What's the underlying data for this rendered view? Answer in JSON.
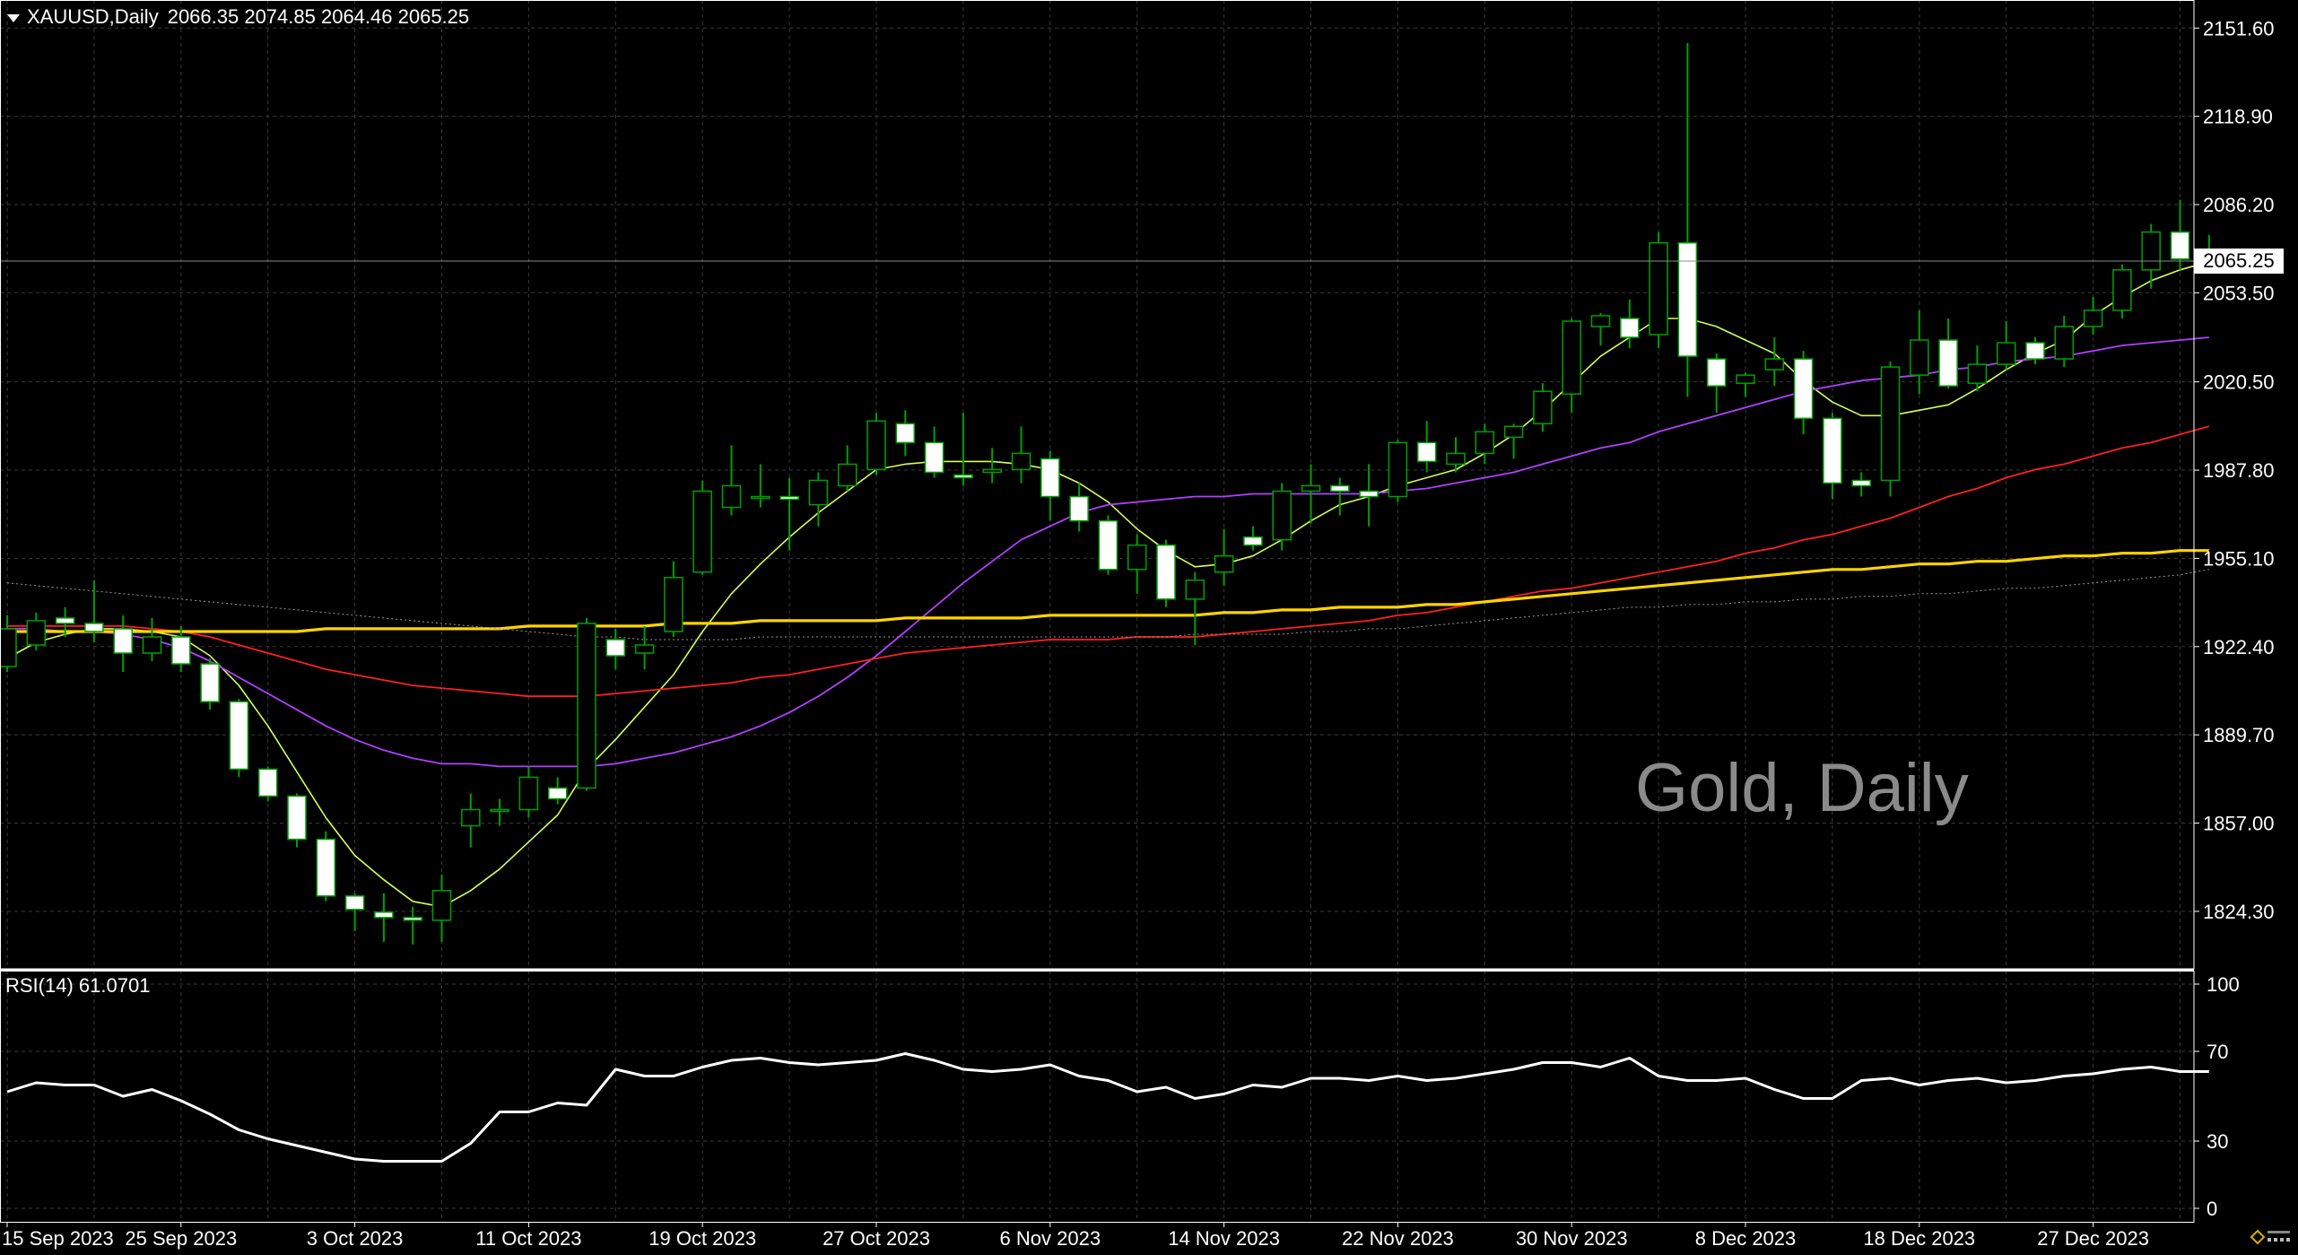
{
  "symbol_header": {
    "symbol": "XAUUSD,Daily",
    "ohlc": "2066.35 2074.85 2064.46 2065.25"
  },
  "watermark": "Gold, Daily",
  "rsi_header": "RSI(14) 61.0701",
  "current_price_label": "2065.25",
  "colors": {
    "background": "#000000",
    "grid": "#3a3a3a",
    "bull_candle": "#00a000",
    "bear_candle_fill": "#ffffff",
    "ma_fast": "#d4ff5c",
    "ma_mid": "#b040ff",
    "ma_slow": "#ff2020",
    "ma_long": "#ffd400",
    "ma_longest": "#9a9a9a",
    "rsi": "#ffffff"
  },
  "chart_data": {
    "type": "candlestick",
    "price_axis": {
      "ticks": [
        2151.6,
        2118.9,
        2086.2,
        2053.5,
        2020.5,
        1987.8,
        1955.1,
        1922.4,
        1889.7,
        1857.0,
        1824.3
      ],
      "labels": [
        "2151.60",
        "2118.90",
        "2086.20",
        "2053.50",
        "2020.50",
        "1987.80",
        "1955.10",
        "1922.40",
        "1889.70",
        "1857.00",
        "1824.30"
      ],
      "range": [
        1803,
        2162
      ],
      "current": 2065.25
    },
    "x_axis": {
      "labels": [
        "15 Sep 2023",
        "25 Sep 2023",
        "3 Oct 2023",
        "11 Oct 2023",
        "19 Oct 2023",
        "27 Oct 2023",
        "6 Nov 2023",
        "14 Nov 2023",
        "22 Nov 2023",
        "30 Nov 2023",
        "8 Dec 2023",
        "18 Dec 2023",
        "27 Dec 2023"
      ],
      "label_bar_index": [
        0,
        6,
        12,
        18,
        24,
        30,
        36,
        42,
        48,
        54,
        60,
        66,
        72
      ]
    },
    "candles": [
      {
        "o": 1915,
        "h": 1934,
        "l": 1913,
        "c": 1929
      },
      {
        "o": 1923,
        "h": 1935,
        "l": 1921,
        "c": 1932
      },
      {
        "o": 1933,
        "h": 1937,
        "l": 1926,
        "c": 1931
      },
      {
        "o": 1931,
        "h": 1947,
        "l": 1924,
        "c": 1928
      },
      {
        "o": 1929,
        "h": 1934,
        "l": 1913,
        "c": 1920
      },
      {
        "o": 1920,
        "h": 1933,
        "l": 1917,
        "c": 1926
      },
      {
        "o": 1926,
        "h": 1930,
        "l": 1913,
        "c": 1916
      },
      {
        "o": 1916,
        "h": 1918,
        "l": 1899,
        "c": 1902
      },
      {
        "o": 1902,
        "h": 1903,
        "l": 1874,
        "c": 1877
      },
      {
        "o": 1877,
        "h": 1878,
        "l": 1865,
        "c": 1867
      },
      {
        "o": 1867,
        "h": 1868,
        "l": 1848,
        "c": 1851
      },
      {
        "o": 1851,
        "h": 1854,
        "l": 1828,
        "c": 1830
      },
      {
        "o": 1830,
        "h": 1831,
        "l": 1817,
        "c": 1825
      },
      {
        "o": 1824,
        "h": 1831,
        "l": 1813,
        "c": 1822
      },
      {
        "o": 1822,
        "h": 1826,
        "l": 1812,
        "c": 1821
      },
      {
        "o": 1821,
        "h": 1838,
        "l": 1813,
        "c": 1832
      },
      {
        "o": 1856,
        "h": 1868,
        "l": 1848,
        "c": 1862
      },
      {
        "o": 1862,
        "h": 1866,
        "l": 1856,
        "c": 1862
      },
      {
        "o": 1862,
        "h": 1878,
        "l": 1859,
        "c": 1874
      },
      {
        "o": 1870,
        "h": 1874,
        "l": 1864,
        "c": 1866
      },
      {
        "o": 1870,
        "h": 1933,
        "l": 1869,
        "c": 1931
      },
      {
        "o": 1925,
        "h": 1929,
        "l": 1914,
        "c": 1919
      },
      {
        "o": 1920,
        "h": 1930,
        "l": 1914,
        "c": 1923
      },
      {
        "o": 1928,
        "h": 1954,
        "l": 1926,
        "c": 1948
      },
      {
        "o": 1950,
        "h": 1984,
        "l": 1949,
        "c": 1980
      },
      {
        "o": 1974,
        "h": 1997,
        "l": 1971,
        "c": 1982
      },
      {
        "o": 1978,
        "h": 1990,
        "l": 1974,
        "c": 1978
      },
      {
        "o": 1978,
        "h": 1985,
        "l": 1958,
        "c": 1977
      },
      {
        "o": 1975,
        "h": 1987,
        "l": 1967,
        "c": 1984
      },
      {
        "o": 1982,
        "h": 1997,
        "l": 1980,
        "c": 1990
      },
      {
        "o": 1988,
        "h": 2009,
        "l": 1986,
        "c": 2006
      },
      {
        "o": 2005,
        "h": 2010,
        "l": 1993,
        "c": 1998
      },
      {
        "o": 1998,
        "h": 2004,
        "l": 1985,
        "c": 1987
      },
      {
        "o": 1986,
        "h": 2009,
        "l": 1982,
        "c": 1985
      },
      {
        "o": 1987,
        "h": 1996,
        "l": 1983,
        "c": 1988
      },
      {
        "o": 1988,
        "h": 2004,
        "l": 1983,
        "c": 1994
      },
      {
        "o": 1992,
        "h": 1995,
        "l": 1969,
        "c": 1978
      },
      {
        "o": 1978,
        "h": 1983,
        "l": 1965,
        "c": 1969
      },
      {
        "o": 1969,
        "h": 1971,
        "l": 1949,
        "c": 1951
      },
      {
        "o": 1951,
        "h": 1964,
        "l": 1942,
        "c": 1960
      },
      {
        "o": 1960,
        "h": 1962,
        "l": 1937,
        "c": 1940
      },
      {
        "o": 1940,
        "h": 1950,
        "l": 1923,
        "c": 1947
      },
      {
        "o": 1950,
        "h": 1966,
        "l": 1945,
        "c": 1956
      },
      {
        "o": 1963,
        "h": 1967,
        "l": 1958,
        "c": 1960
      },
      {
        "o": 1962,
        "h": 1983,
        "l": 1958,
        "c": 1980
      },
      {
        "o": 1980,
        "h": 1990,
        "l": 1968,
        "c": 1982
      },
      {
        "o": 1982,
        "h": 1985,
        "l": 1971,
        "c": 1980
      },
      {
        "o": 1980,
        "h": 1990,
        "l": 1967,
        "c": 1978
      },
      {
        "o": 1978,
        "h": 1999,
        "l": 1976,
        "c": 1998
      },
      {
        "o": 1998,
        "h": 2006,
        "l": 1987,
        "c": 1991
      },
      {
        "o": 1990,
        "h": 2000,
        "l": 1987,
        "c": 1994
      },
      {
        "o": 1994,
        "h": 2005,
        "l": 1990,
        "c": 2002
      },
      {
        "o": 2000,
        "h": 2005,
        "l": 1992,
        "c": 2004
      },
      {
        "o": 2005,
        "h": 2020,
        "l": 2002,
        "c": 2017
      },
      {
        "o": 2016,
        "h": 2044,
        "l": 2009,
        "c": 2043
      },
      {
        "o": 2041,
        "h": 2046,
        "l": 2034,
        "c": 2045
      },
      {
        "o": 2044,
        "h": 2051,
        "l": 2033,
        "c": 2037
      },
      {
        "o": 2038,
        "h": 2076,
        "l": 2033,
        "c": 2072
      },
      {
        "o": 2072,
        "h": 2146,
        "l": 2015,
        "c": 2030
      },
      {
        "o": 2029,
        "h": 2031,
        "l": 2009,
        "c": 2019
      },
      {
        "o": 2020,
        "h": 2024,
        "l": 2015,
        "c": 2023
      },
      {
        "o": 2025,
        "h": 2037,
        "l": 2019,
        "c": 2029
      },
      {
        "o": 2029,
        "h": 2032,
        "l": 2001,
        "c": 2007
      },
      {
        "o": 2007,
        "h": 2009,
        "l": 1977,
        "c": 1983
      },
      {
        "o": 1984,
        "h": 1987,
        "l": 1978,
        "c": 1982
      },
      {
        "o": 1984,
        "h": 2028,
        "l": 1978,
        "c": 2026
      },
      {
        "o": 2023,
        "h": 2047,
        "l": 2016,
        "c": 2036
      },
      {
        "o": 2036,
        "h": 2044,
        "l": 2018,
        "c": 2019
      },
      {
        "o": 2020,
        "h": 2034,
        "l": 2017,
        "c": 2027
      },
      {
        "o": 2027,
        "h": 2043,
        "l": 2025,
        "c": 2035
      },
      {
        "o": 2035,
        "h": 2037,
        "l": 2027,
        "c": 2029
      },
      {
        "o": 2029,
        "h": 2045,
        "l": 2026,
        "c": 2041
      },
      {
        "o": 2041,
        "h": 2052,
        "l": 2038,
        "c": 2047
      },
      {
        "o": 2047,
        "h": 2064,
        "l": 2044,
        "c": 2062
      },
      {
        "o": 2062,
        "h": 2079,
        "l": 2055,
        "c": 2076
      },
      {
        "o": 2076,
        "h": 2088,
        "l": 2062,
        "c": 2066
      },
      {
        "o": 2066,
        "h": 2075,
        "l": 2064,
        "c": 2065
      }
    ],
    "ma_series": [
      {
        "color_key": "ma_fast",
        "width": 1.6,
        "values": [
          1918,
          1924,
          1927,
          1929,
          1929,
          1928,
          1926,
          1919,
          1908,
          1893,
          1876,
          1859,
          1845,
          1836,
          1828,
          1826,
          1832,
          1840,
          1850,
          1860,
          1877,
          1888,
          1900,
          1912,
          1928,
          1942,
          1953,
          1963,
          1972,
          1980,
          1988,
          1990,
          1991,
          1991,
          1991,
          1990,
          1988,
          1983,
          1976,
          1966,
          1958,
          1952,
          1953,
          1956,
          1962,
          1969,
          1975,
          1978,
          1982,
          1985,
          1988,
          1994,
          2001,
          2010,
          2020,
          2030,
          2037,
          2044,
          2044,
          2041,
          2036,
          2031,
          2021,
          2013,
          2008,
          2008,
          2010,
          2012,
          2018,
          2025,
          2031,
          2036,
          2045,
          2052,
          2058,
          2062,
          2065
        ]
      },
      {
        "color_key": "ma_mid",
        "width": 1.8,
        "values": [
          1929,
          1929,
          1928,
          1928,
          1927,
          1925,
          1922,
          1917,
          1911,
          1905,
          1899,
          1893,
          1888,
          1884,
          1881,
          1879,
          1879,
          1878,
          1878,
          1878,
          1878,
          1879,
          1881,
          1883,
          1886,
          1889,
          1893,
          1898,
          1904,
          1911,
          1919,
          1928,
          1937,
          1946,
          1954,
          1962,
          1967,
          1972,
          1975,
          1976,
          1977,
          1978,
          1978,
          1979,
          1979,
          1979,
          1979,
          1979,
          1980,
          1981,
          1983,
          1985,
          1987,
          1990,
          1993,
          1996,
          1998,
          2002,
          2005,
          2008,
          2011,
          2014,
          2017,
          2019,
          2021,
          2022,
          2023,
          2025,
          2026,
          2028,
          2029,
          2030,
          2032,
          2034,
          2035,
          2036,
          2037
        ]
      },
      {
        "color_key": "ma_slow",
        "width": 1.8,
        "values": [
          1930,
          1930,
          1930,
          1930,
          1930,
          1929,
          1928,
          1926,
          1923,
          1920,
          1917,
          1914,
          1912,
          1910,
          1908,
          1907,
          1906,
          1905,
          1904,
          1904,
          1904,
          1905,
          1906,
          1907,
          1908,
          1909,
          1911,
          1912,
          1914,
          1916,
          1918,
          1920,
          1921,
          1922,
          1923,
          1924,
          1925,
          1925,
          1925,
          1926,
          1926,
          1926,
          1927,
          1928,
          1929,
          1930,
          1931,
          1932,
          1934,
          1935,
          1937,
          1939,
          1941,
          1943,
          1944,
          1946,
          1948,
          1950,
          1952,
          1954,
          1957,
          1959,
          1962,
          1964,
          1967,
          1970,
          1974,
          1978,
          1981,
          1985,
          1988,
          1990,
          1993,
          1996,
          1998,
          2001,
          2004
        ]
      },
      {
        "color_key": "ma_long",
        "width": 3.2,
        "values": [
          1928,
          1928,
          1928,
          1928,
          1928,
          1928,
          1928,
          1928,
          1928,
          1928,
          1928,
          1929,
          1929,
          1929,
          1929,
          1929,
          1929,
          1929,
          1930,
          1930,
          1930,
          1930,
          1930,
          1931,
          1931,
          1931,
          1932,
          1932,
          1932,
          1932,
          1932,
          1933,
          1933,
          1933,
          1933,
          1933,
          1934,
          1934,
          1934,
          1934,
          1934,
          1934,
          1935,
          1935,
          1936,
          1936,
          1937,
          1937,
          1937,
          1938,
          1938,
          1939,
          1940,
          1941,
          1942,
          1943,
          1944,
          1945,
          1946,
          1947,
          1948,
          1949,
          1950,
          1951,
          1951,
          1952,
          1953,
          1953,
          1954,
          1954,
          1955,
          1956,
          1956,
          1957,
          1957,
          1958,
          1958
        ]
      },
      {
        "color_key": "ma_longest",
        "width": 1.0,
        "dashed": true,
        "values": [
          1946,
          1945,
          1944,
          1943,
          1942,
          1941,
          1940,
          1939,
          1938,
          1937,
          1936,
          1935,
          1934,
          1933,
          1932,
          1931,
          1930,
          1929,
          1928,
          1927,
          1926,
          1926,
          1925,
          1925,
          1925,
          1925,
          1926,
          1926,
          1926,
          1926,
          1926,
          1926,
          1926,
          1926,
          1926,
          1926,
          1926,
          1926,
          1926,
          1926,
          1926,
          1927,
          1927,
          1927,
          1927,
          1928,
          1928,
          1929,
          1929,
          1930,
          1931,
          1932,
          1933,
          1934,
          1935,
          1936,
          1937,
          1937,
          1938,
          1938,
          1939,
          1939,
          1940,
          1940,
          1941,
          1941,
          1942,
          1942,
          1943,
          1944,
          1944,
          1945,
          1946,
          1947,
          1948,
          1949,
          1951
        ]
      }
    ],
    "rsi": {
      "label": "RSI(14) 61.0701",
      "range": [
        0,
        100
      ],
      "ticks": [
        100,
        70,
        30,
        0
      ],
      "tick_labels": [
        "100",
        "70",
        "30",
        "0"
      ],
      "values": [
        52,
        56,
        55,
        55,
        50,
        53,
        48,
        42,
        35,
        31,
        28,
        25,
        22,
        21,
        21,
        21,
        29,
        43,
        43,
        47,
        46,
        62,
        59,
        59,
        63,
        66,
        67,
        65,
        64,
        65,
        66,
        69,
        66,
        62,
        61,
        62,
        64,
        59,
        57,
        52,
        54,
        49,
        51,
        55,
        54,
        58,
        58,
        57,
        59,
        57,
        58,
        60,
        62,
        65,
        65,
        63,
        67,
        59,
        57,
        57,
        58,
        53,
        49,
        49,
        57,
        58,
        55,
        57,
        58,
        56,
        57,
        59,
        60,
        62,
        63,
        61,
        61
      ]
    }
  }
}
